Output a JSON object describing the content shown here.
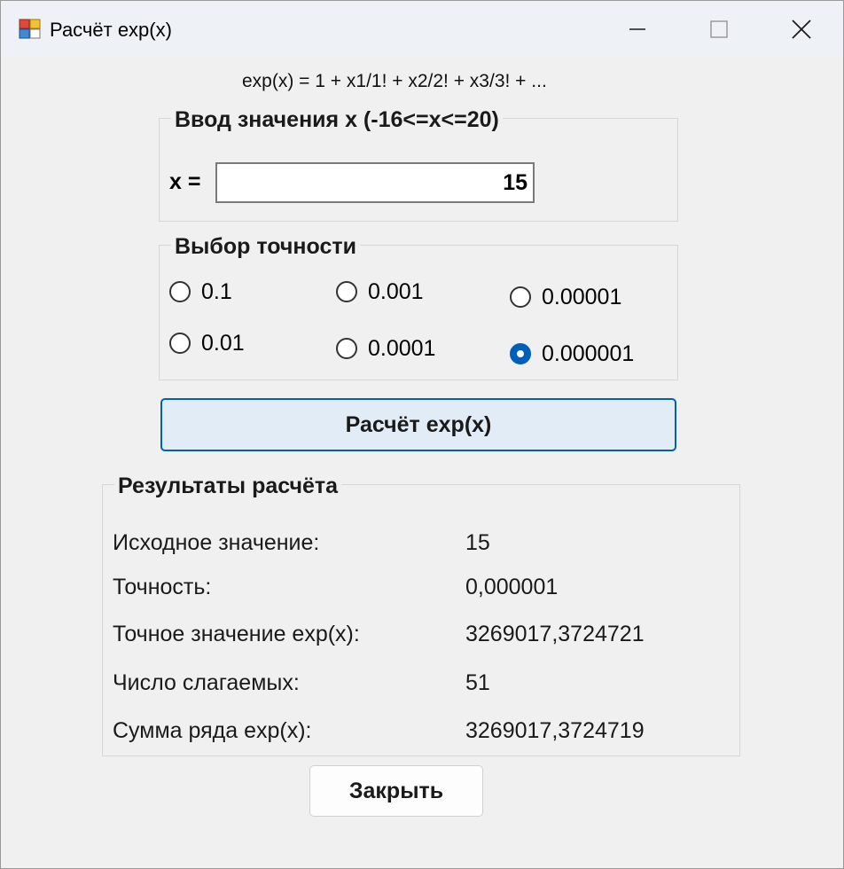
{
  "window": {
    "title": "Расчёт exp(x)"
  },
  "formula": "exp(x) = 1 + x1/1! + x2/2! + x3/3! + ...",
  "input_group": {
    "caption": "Ввод значения x (-16<=x<=20)",
    "x_label": "x =",
    "x_value": "15"
  },
  "precision_group": {
    "caption": "Выбор точности",
    "options": [
      "0.1",
      "0.01",
      "0.001",
      "0.0001",
      "0.00001",
      "0.000001"
    ],
    "selected": "0.000001"
  },
  "calc_button_label": "Расчёт exp(x)",
  "results": {
    "caption": "Результаты расчёта",
    "rows": [
      {
        "label": "Исходное значение:",
        "value": "15"
      },
      {
        "label": "Точность:",
        "value": "0,000001"
      },
      {
        "label": "Точное значение exp(x):",
        "value": "3269017,3724721"
      },
      {
        "label": "Число слагаемых:",
        "value": "51"
      },
      {
        "label": "Сумма ряда exp(x):",
        "value": "3269017,3724719"
      }
    ]
  },
  "close_button_label": "Закрыть",
  "colors": {
    "accent": "#005fb8",
    "button_fill": "#e1ecf7",
    "background": "#f0f0f0"
  }
}
